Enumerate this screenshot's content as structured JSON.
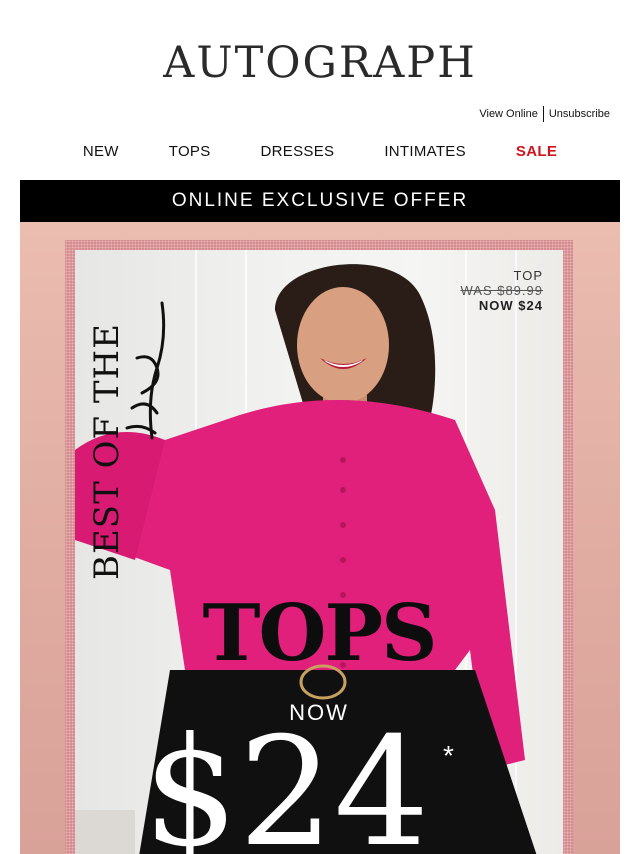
{
  "brand": {
    "logo_text": "AUTOGRAPH"
  },
  "utility_links": {
    "view_online": "View Online",
    "unsubscribe": "Unsubscribe"
  },
  "nav": {
    "items": [
      {
        "label": "NEW"
      },
      {
        "label": "TOPS"
      },
      {
        "label": "DRESSES"
      },
      {
        "label": "INTIMATES"
      },
      {
        "label": "SALE"
      }
    ]
  },
  "banner": {
    "text": "ONLINE EXCLUSIVE OFFER"
  },
  "hero": {
    "vertical_title": "BEST OF THE",
    "script_word": "Best",
    "price_tag": {
      "item": "TOP",
      "was": "WAS $89.99",
      "now": "NOW $24"
    },
    "headline": "TOPS",
    "now_label": "NOW",
    "big_price": "$24",
    "asterisk": "*"
  },
  "colors": {
    "sale": "#d0141e",
    "banner_bg": "#000000",
    "hero_bg": "#ebbcb0",
    "blouse": "#e0207a"
  }
}
